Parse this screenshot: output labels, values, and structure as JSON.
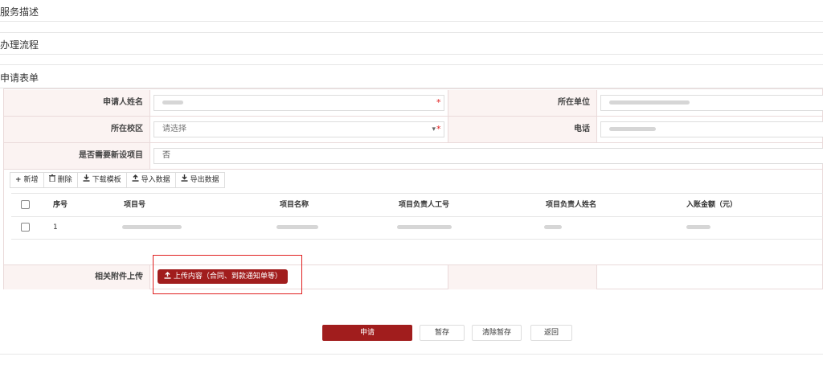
{
  "sections": {
    "service_description": "服务描述",
    "process": "办理流程",
    "application_form": "申请表单"
  },
  "form": {
    "applicant_name_label": "申请人姓名",
    "unit_label": "所在单位",
    "campus_label": "所在校区",
    "campus_placeholder": "请选择",
    "phone_label": "电话",
    "need_new_project_label": "是否需要新设项目",
    "need_new_project_value": "否",
    "required_mark": "*",
    "dropdown_arrow": "▾"
  },
  "toolbar": {
    "add": "新增",
    "delete": "删除",
    "download_template": "下载模板",
    "import_data": "导入数据",
    "export_data": "导出数据",
    "icons": {
      "add": "plus-icon",
      "delete": "trash-icon",
      "download": "download-icon",
      "import": "upload-icon",
      "export": "download-icon"
    }
  },
  "table": {
    "columns": [
      "序号",
      "项目号",
      "项目名称",
      "项目负责人工号",
      "项目负责人姓名",
      "入账金额（元）"
    ],
    "rows": [
      {
        "index": "1"
      }
    ]
  },
  "attachments": {
    "label": "相关附件上传",
    "upload_button": "上传内容（合同、到款通知单等）"
  },
  "actions": {
    "apply": "申请",
    "save_draft": "暂存",
    "clear_draft": "清除暂存",
    "back": "返回"
  },
  "colors": {
    "primary": "#a11d1d",
    "label_bg": "#fbf3f2",
    "highlight": "#e02020"
  }
}
